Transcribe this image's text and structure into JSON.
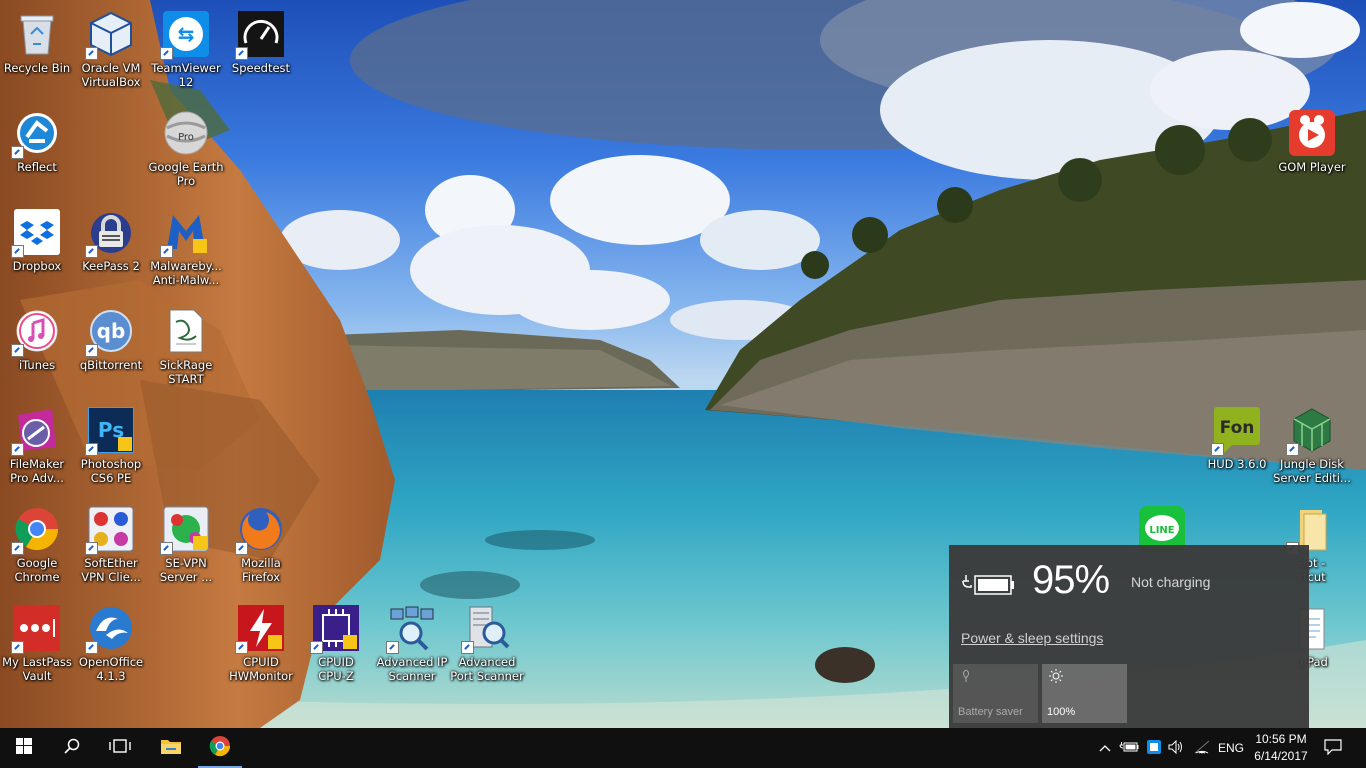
{
  "desktop": {
    "icons": [
      {
        "label1": "Recycle Bin",
        "label2": ""
      },
      {
        "label1": "Oracle VM",
        "label2": "VirtualBox"
      },
      {
        "label1": "TeamViewer",
        "label2": "12"
      },
      {
        "label1": "Speedtest",
        "label2": ""
      },
      {
        "label1": "Reflect",
        "label2": ""
      },
      {
        "label1": "Google Earth",
        "label2": "Pro"
      },
      {
        "label1": "Dropbox",
        "label2": ""
      },
      {
        "label1": "KeePass 2",
        "label2": ""
      },
      {
        "label1": "Malwareby...",
        "label2": "Anti-Malw..."
      },
      {
        "label1": "iTunes",
        "label2": ""
      },
      {
        "label1": "qBittorrent",
        "label2": ""
      },
      {
        "label1": "SickRage",
        "label2": "START"
      },
      {
        "label1": "FileMaker",
        "label2": "Pro Adv..."
      },
      {
        "label1": "Photoshop",
        "label2": "CS6 PE"
      },
      {
        "label1": "Google",
        "label2": "Chrome"
      },
      {
        "label1": "SoftEther",
        "label2": "VPN Clie..."
      },
      {
        "label1": "SE-VPN",
        "label2": "Server ..."
      },
      {
        "label1": "Mozilla",
        "label2": "Firefox"
      },
      {
        "label1": "My LastPass",
        "label2": "Vault"
      },
      {
        "label1": "OpenOffice",
        "label2": "4.1.3"
      },
      {
        "label1": "CPUID",
        "label2": "HWMonitor"
      },
      {
        "label1": "CPUID",
        "label2": "CPU-Z"
      },
      {
        "label1": "Advanced IP",
        "label2": "Scanner"
      },
      {
        "label1": "Advanced",
        "label2": "Port Scanner"
      },
      {
        "label1": "GOM Player",
        "label2": ""
      },
      {
        "label1": "HUD 3.6.0",
        "label2": ""
      },
      {
        "label1": "Jungle Disk",
        "label2": "Server Editi..."
      },
      {
        "label1": "",
        "label2": ""
      },
      {
        "label1": "ept -",
        "label2": "rtcut"
      },
      {
        "label1": "g Pad",
        "label2": ""
      }
    ],
    "icon_glyphs": {
      "teamviewer": "⇆",
      "qbittorrent": "qb",
      "photoshop": "Ps",
      "fon": "Fon",
      "line": "LINE",
      "google_earth_badge": "Pro"
    }
  },
  "battery_flyout": {
    "percent": "95%",
    "status": "Not charging",
    "settings_link": "Power & sleep settings",
    "battery_saver_label": "Battery saver",
    "brightness_label": "100%"
  },
  "taskbar": {
    "language": "ENG",
    "time": "10:56 PM",
    "date": "6/14/2017"
  },
  "colors": {
    "taskbar_bg": "#101010",
    "flyout_bg": "#3a3a3a",
    "accent": "#7aa7e6"
  }
}
